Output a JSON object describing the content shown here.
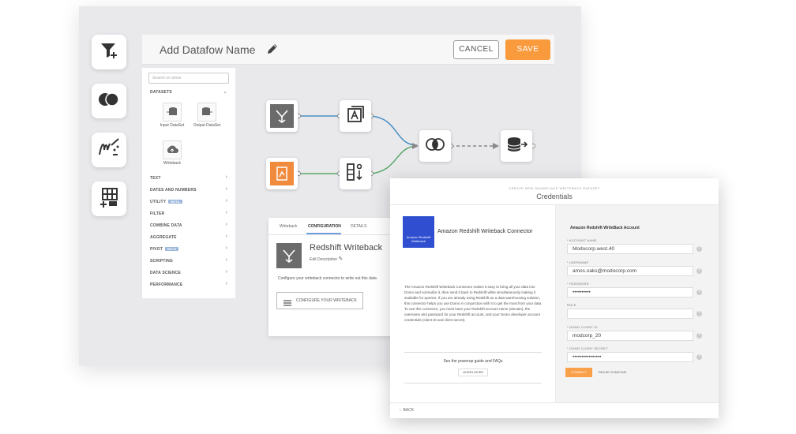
{
  "header": {
    "title": "Add Datafow Name",
    "cancel_label": "CANCEL",
    "save_label": "SAVE"
  },
  "tools": [
    "filter-icon",
    "combine-icon",
    "scripting-icon",
    "table-icon"
  ],
  "sidebar": {
    "search_placeholder": "Search on amos",
    "datasets_label": "DATASETS",
    "datasets": [
      "Input DataSet",
      "Output DataSet",
      "Writeback"
    ],
    "sections": [
      {
        "label": "TEXT"
      },
      {
        "label": "DATES AND NUMBERS"
      },
      {
        "label": "UTILITY",
        "tag": "BETA"
      },
      {
        "label": "FILTER"
      },
      {
        "label": "COMBINE DATA"
      },
      {
        "label": "AGGREGATE"
      },
      {
        "label": "PIVOT",
        "tag": "BETA"
      },
      {
        "label": "SCRIPTING"
      },
      {
        "label": "DATA SCIENCE"
      },
      {
        "label": "PERFORMANCE"
      }
    ]
  },
  "config": {
    "tabs": [
      "Writeback",
      "CONFIGURATION",
      "DETAILS"
    ],
    "title": "Redshift Writeback",
    "edit_description": "Edit Description",
    "text": "Configure your writeback connector to write out this data",
    "button": "CONFIGURE YOUR WRITEBACK"
  },
  "dialog": {
    "super_title": "CREATE NEW SNOWFLAKE WRITEBACK DATASET",
    "title": "Credentials",
    "logo_text": "Amazon Redshift Writeback",
    "connector_name": "Amazon Redshift Writeback Connector",
    "description": "The Amazon Redshift Writeback Connector makes it easy to bring all your data into Domo and normalize it, then send it back to Redshift while simultaneously making it available for queries. If you are already using Redshift as a data warehousing solution, this connector helps you use Domo in conjunction with it to get the most from your data. To use this connector, you must have your Redshift account name (domain), the username and password for your Redshift account, and your Domo developer account credentials (client ID and client secret).",
    "guide_text": "See the powerup guide and FAQs",
    "learn_more": "LEARN MORE",
    "account_title": "Amazon Redshift WriteBack Account",
    "fields": [
      {
        "label": "* ACCOUNT NAME",
        "value": "Modocorp.west.40"
      },
      {
        "label": "* USERNAME",
        "value": "amos.oaks@modocorp.com"
      },
      {
        "label": "* PASSWORD",
        "value": "••••••••••"
      },
      {
        "label": "ROLE",
        "value": ""
      },
      {
        "label": "* DOMO CLIENT ID",
        "value": "modcorp_20"
      },
      {
        "label": "* DOMO CLIENT SECRET",
        "value": "••••••••••••••••"
      }
    ],
    "connect_label": "CONNECT",
    "manage_label": "REUSE SOMEONE",
    "back_label": "BACK"
  },
  "colors": {
    "accent": "#f99a3d",
    "line_blue": "#4a90c2",
    "line_green": "#5aa86a",
    "input_orange": "#f08a3c"
  }
}
